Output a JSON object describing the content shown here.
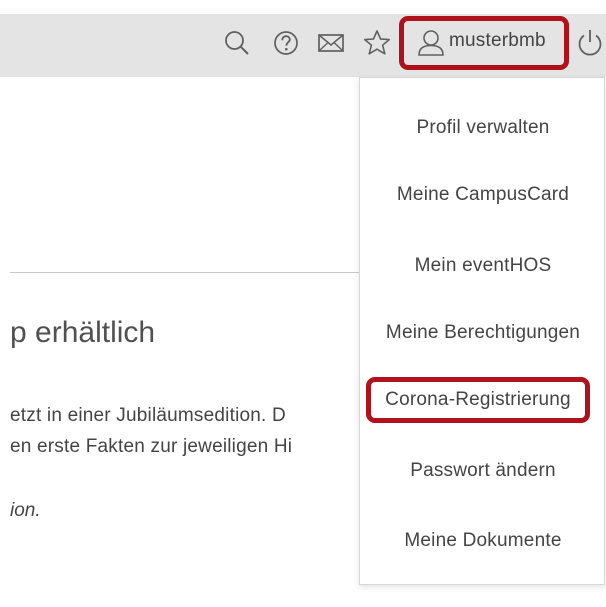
{
  "header": {
    "username": "musterbmb",
    "icons": [
      "search-icon",
      "help-icon",
      "mail-icon",
      "star-icon",
      "user-icon",
      "power-icon"
    ]
  },
  "content": {
    "heading": "p erhältlich",
    "paragraph_line1": "etzt in einer Jubiläumsedition. D",
    "paragraph_line2": "en erste Fakten zur jeweiligen Hi",
    "italic_text": "ion."
  },
  "user_menu": {
    "items": [
      {
        "label": "Profil verwalten"
      },
      {
        "label": "Meine CampusCard"
      },
      {
        "label": "Mein eventHOS"
      },
      {
        "label": "Meine Berechtigungen"
      },
      {
        "label": "Corona-Registrierung"
      },
      {
        "label": "Passwort ändern"
      },
      {
        "label": "Meine Dokumente"
      }
    ]
  },
  "colors": {
    "highlight": "#b0121c",
    "topbar": "#e4e4e4",
    "text": "#444444"
  }
}
